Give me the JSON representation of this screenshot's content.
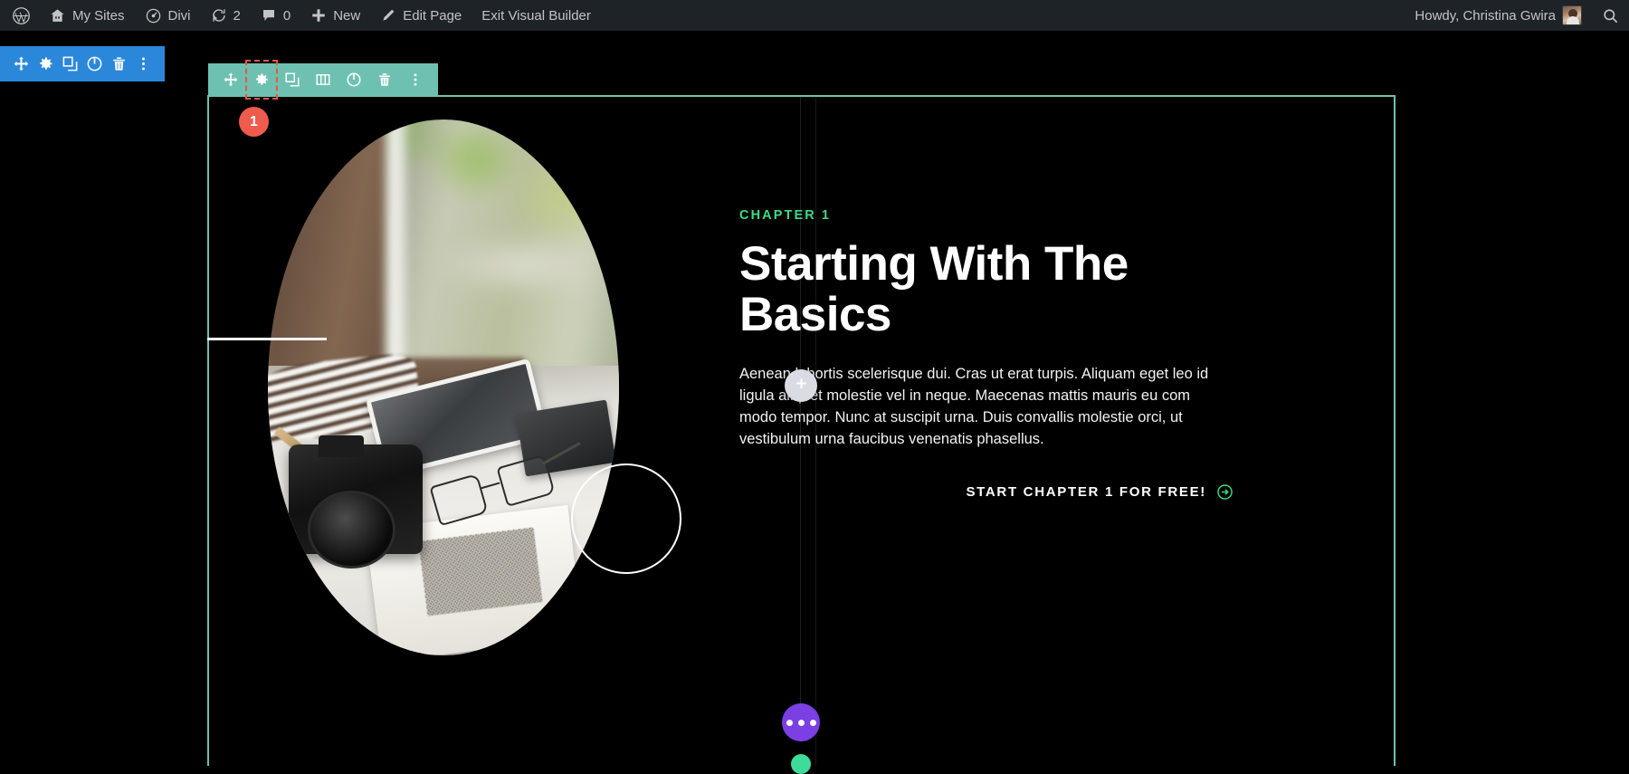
{
  "admin_bar": {
    "items": [
      {
        "icon": "wordpress-logo-icon",
        "label": ""
      },
      {
        "icon": "my-sites-icon",
        "label": "My Sites"
      },
      {
        "icon": "divi-icon",
        "label": "Divi"
      },
      {
        "icon": "updates-icon",
        "label": "2"
      },
      {
        "icon": "comments-icon",
        "label": "0"
      },
      {
        "icon": "new-plus-icon",
        "label": "New"
      },
      {
        "icon": "edit-pencil-icon",
        "label": "Edit Page"
      },
      {
        "icon": "",
        "label": "Exit Visual Builder"
      }
    ],
    "my_sites_label": "My Sites",
    "divi_label": "Divi",
    "updates_count": "2",
    "comments_count": "0",
    "new_label": "New",
    "edit_page_label": "Edit Page",
    "exit_builder_label": "Exit Visual Builder",
    "howdy_label": "Howdy, Christina Gwira",
    "search_icon": "search-icon"
  },
  "page_toolbar": {
    "color": "#2b87da",
    "buttons": [
      {
        "name": "move-handle",
        "icon": "move-arrows-icon"
      },
      {
        "name": "page-settings",
        "icon": "gear-icon"
      },
      {
        "name": "duplicate",
        "icon": "duplicate-icon"
      },
      {
        "name": "disable",
        "icon": "power-icon"
      },
      {
        "name": "delete",
        "icon": "trash-icon"
      },
      {
        "name": "more-options",
        "icon": "kebab-menu-icon"
      }
    ]
  },
  "section_toolbar": {
    "color": "#6ec1b0",
    "focused_button": "section-settings",
    "buttons": [
      {
        "name": "move-handle",
        "icon": "move-arrows-icon"
      },
      {
        "name": "section-settings",
        "icon": "gear-icon"
      },
      {
        "name": "duplicate",
        "icon": "duplicate-icon"
      },
      {
        "name": "column-structure",
        "icon": "columns-icon"
      },
      {
        "name": "disable",
        "icon": "power-icon"
      },
      {
        "name": "delete",
        "icon": "trash-icon"
      },
      {
        "name": "more-options",
        "icon": "kebab-menu-icon"
      }
    ]
  },
  "section": {
    "badge_number": "1",
    "border_color": "#6ec1b0",
    "badge_color": "#ef5b4c"
  },
  "content": {
    "eyebrow": "CHAPTER 1",
    "eyebrow_color": "#3ddc84",
    "heading": "Starting With The Basics",
    "body": "Aenean lobortis scelerisque dui. Cras ut erat turpis. Aliquam eget leo id ligula aliquet molestie vel in neque. Maecenas mattis mauris eu com modo tempor. Nunc at suscipit urna. Duis convallis molestie orci, ut vestibulum urna faucibus venenatis phasellus.",
    "cta_label": "START CHAPTER 1 FOR FREE!",
    "cta_icon": "circle-arrow-right-icon",
    "cta_color": "#3ddc84"
  },
  "floating": {
    "add_row": {
      "name": "add-row-button",
      "icon": "plus-icon",
      "color": "#d9dce3"
    },
    "options": {
      "name": "page-options-button",
      "icon": "ellipsis-icon",
      "color": "#7b3fe4"
    },
    "teal": {
      "name": "add-section-button",
      "color": "#3ddc9b"
    }
  }
}
